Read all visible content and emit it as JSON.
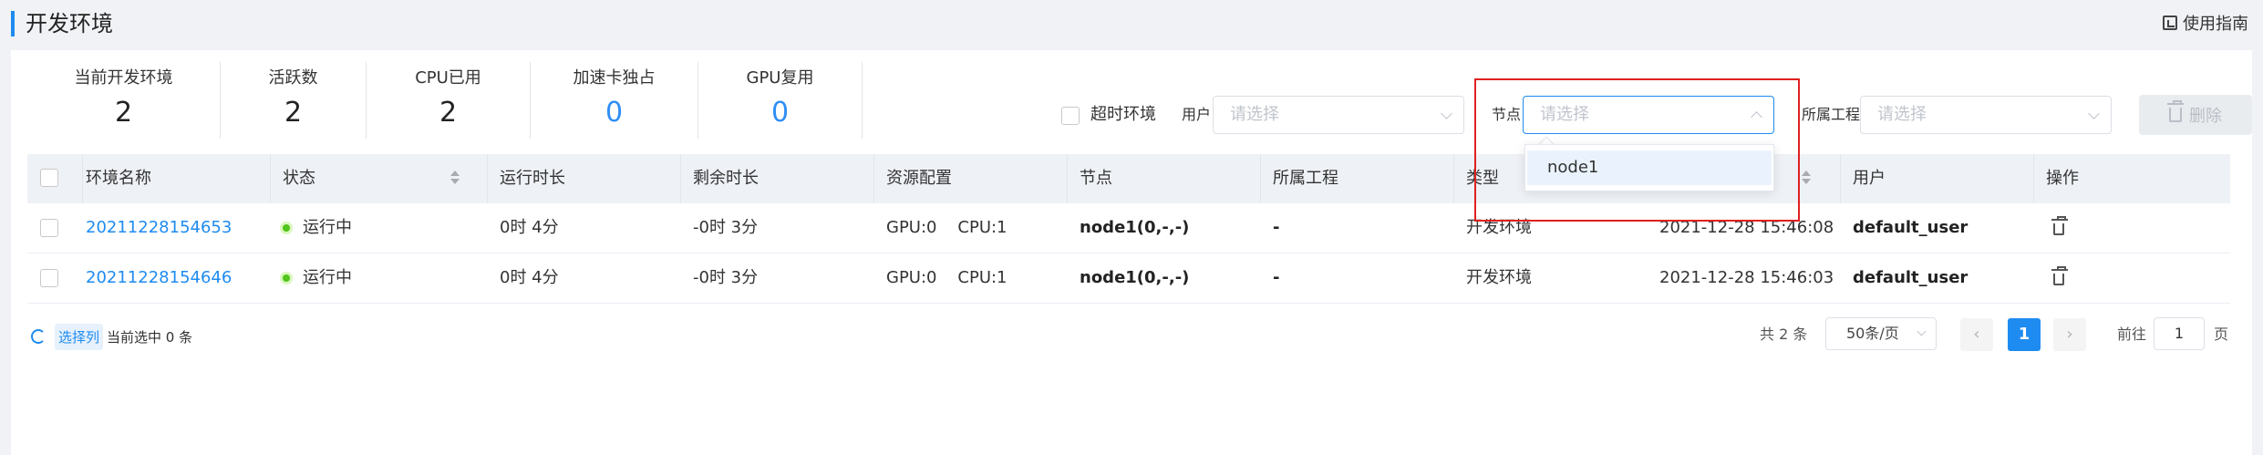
{
  "header": {
    "title": "开发环境",
    "guide_label": "使用指南"
  },
  "stats": [
    {
      "label": "当前开发环境",
      "value": "2"
    },
    {
      "label": "活跃数",
      "value": "2"
    },
    {
      "label": "CPU已用",
      "value": "2"
    },
    {
      "label": "加速卡独占",
      "value": "0"
    },
    {
      "label": "GPU复用",
      "value": "0"
    }
  ],
  "filters": {
    "timeout_label": "超时环境",
    "user_label": "用户",
    "user_placeholder": "请选择",
    "node_label": "节点",
    "node_placeholder": "请选择",
    "project_label": "所属工程",
    "project_placeholder": "请选择",
    "delete_label": "删除"
  },
  "node_dropdown": {
    "options": [
      "node1"
    ]
  },
  "table": {
    "columns": [
      "环境名称",
      "状态",
      "运行时长",
      "剩余时长",
      "资源配置",
      "节点",
      "所属工程",
      "类型",
      "用户",
      "操作"
    ],
    "rows": [
      {
        "name": "20211228154653",
        "status": "运行中",
        "run_time": "0时 4分",
        "remaining": "-0时 3分",
        "gpu": "GPU:0",
        "cpu": "CPU:1",
        "node": "node1(0,-,-)",
        "project": "-",
        "type": "开发环境",
        "created": "2021-12-28 15:46:08",
        "user": "default_user"
      },
      {
        "name": "20211228154646",
        "status": "运行中",
        "run_time": "0时 4分",
        "remaining": "-0时 3分",
        "gpu": "GPU:0",
        "cpu": "CPU:1",
        "node": "node1(0,-,-)",
        "project": "-",
        "type": "开发环境",
        "created": "2021-12-28 15:46:03",
        "user": "default_user"
      }
    ]
  },
  "footer": {
    "select_columns": "选择列",
    "selected_text": "当前选中 0 条",
    "total": "共 2 条",
    "page_size": "50条/页",
    "current_page": "1",
    "goto_label": "前往",
    "goto_value": "1",
    "page_unit": "页"
  },
  "colors": {
    "accent": "#1e8bf0",
    "status_running": "#52c41a",
    "highlight": "#e02020"
  }
}
